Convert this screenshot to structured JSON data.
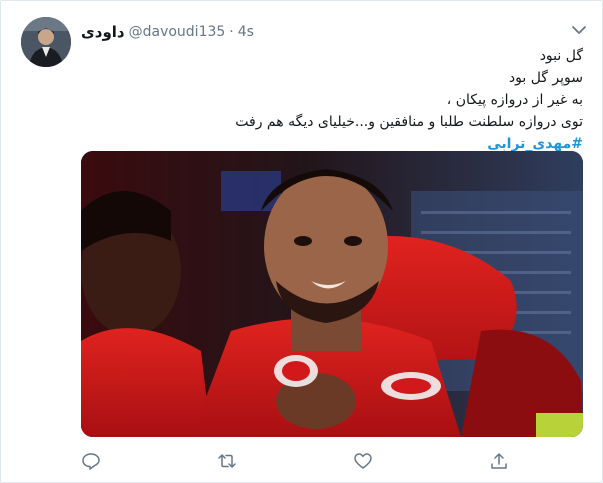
{
  "tweet": {
    "author_name": "داودی",
    "handle": "@davoudi135",
    "separator": "·",
    "time": "4s",
    "lines": [
      "گل نبود",
      "سوپر گل بود",
      "به غیر از  دروازه پیکان ،",
      "توی دروازه سلطنت طلبا و منافقین و...خیلیای دیگه هم رفت"
    ],
    "hashtag": "#مهدی_ترابی"
  },
  "icons": {
    "more": "chevron-down-icon",
    "reply": "reply-icon",
    "retweet": "retweet-icon",
    "like": "heart-icon",
    "share": "share-icon"
  },
  "colors": {
    "link": "#1b95e0",
    "muted": "#657786",
    "jersey_red": "#d3181c"
  }
}
